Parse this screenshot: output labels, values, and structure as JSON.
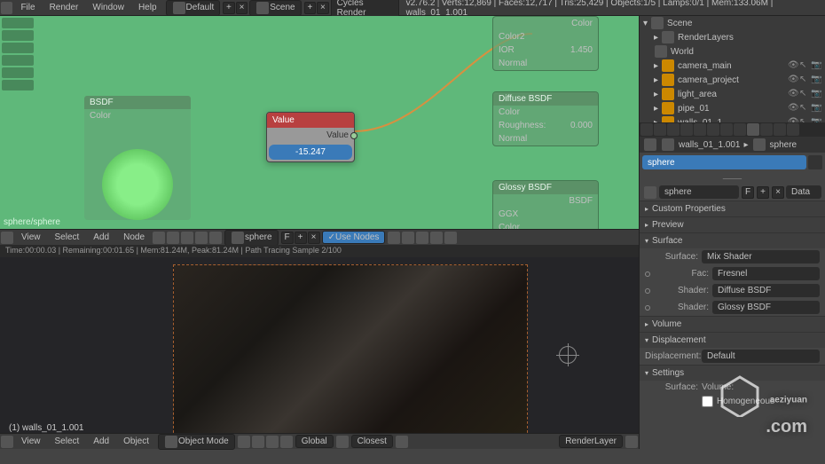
{
  "menu": {
    "file": "File",
    "render": "Render",
    "window": "Window",
    "help": "Help"
  },
  "layout_dd": "Default",
  "scene_dd": "Scene",
  "engine_dd": "Cycles Render",
  "version": "v2.76.2",
  "stats": "Verts:12,869 | Faces:12,717 | Tris:25,429 | Objects:1/5 | Lamps:0/1 | Mem:133.06M | walls_01_1.001",
  "node_editor": {
    "path": "sphere/sphere",
    "menu": {
      "view": "View",
      "select": "Select",
      "add": "Add",
      "node": "Node"
    },
    "material_dd": "sphere",
    "use_nodes": "Use Nodes",
    "f_btn": "F",
    "value_node": {
      "title": "Value",
      "label": "Value",
      "value": "-15.247"
    },
    "color_node": {
      "title": "Color",
      "row": "Color2"
    },
    "ior_node": {
      "label": "IOR",
      "value": "1.450",
      "row2": "Normal"
    },
    "diffuse_node": {
      "title": "Diffuse BSDF",
      "color": "Color",
      "rough": "Roughness:",
      "rough_v": "0.000",
      "normal": "Normal"
    },
    "glossy_node": {
      "title": "Glossy BSDF",
      "bsdf": "BSDF",
      "dist": "GGX",
      "color": "Color"
    },
    "bsdf_label": "BSDF",
    "color_label": "Color"
  },
  "render": {
    "status": "Time:00:00.03 | Remaining:00:01.65 | Mem:81.24M, Peak:81.24M | Path Tracing Sample 2/100",
    "object": "(1) walls_01_1.001"
  },
  "viewport": {
    "menu": {
      "view": "View",
      "select": "Select",
      "add": "Add",
      "object": "Object"
    },
    "mode": "Object Mode",
    "orient": "Global",
    "layer": "RenderLayer",
    "closest": "Closest"
  },
  "outliner": {
    "scene": "Scene",
    "renderlayers": "RenderLayers",
    "world": "World",
    "items": [
      {
        "name": "camera_main",
        "icon": "camera"
      },
      {
        "name": "camera_project",
        "icon": "camera"
      },
      {
        "name": "light_area",
        "icon": "lamp"
      },
      {
        "name": "pipe_01",
        "icon": "mesh"
      },
      {
        "name": "walls_01_1",
        "icon": "mesh"
      }
    ]
  },
  "properties": {
    "breadcrumb_obj": "walls_01_1.001",
    "breadcrumb_mat": "sphere",
    "search": "sphere",
    "obj_dd": "sphere",
    "data_btn": "Data",
    "f_btn": "F",
    "panels": {
      "custom": "Custom Properties",
      "preview": "Preview",
      "surface": "Surface",
      "volume": "Volume",
      "displacement": "Displacement",
      "settings": "Settings"
    },
    "surface": {
      "label": "Surface:",
      "value": "Mix Shader"
    },
    "fac": {
      "label": "Fac:",
      "value": "Fresnel"
    },
    "shader1": {
      "label": "Shader:",
      "value": "Diffuse BSDF"
    },
    "shader2": {
      "label": "Shader:",
      "value": "Glossy BSDF"
    },
    "disp": {
      "label": "Displacement:",
      "value": "Default"
    },
    "settings": {
      "surf": "Surface:",
      "vol": "Volume:",
      "homo": "Homogeneous"
    }
  },
  "watermark": {
    "main": "aeziyuan",
    "sub": ".com"
  }
}
